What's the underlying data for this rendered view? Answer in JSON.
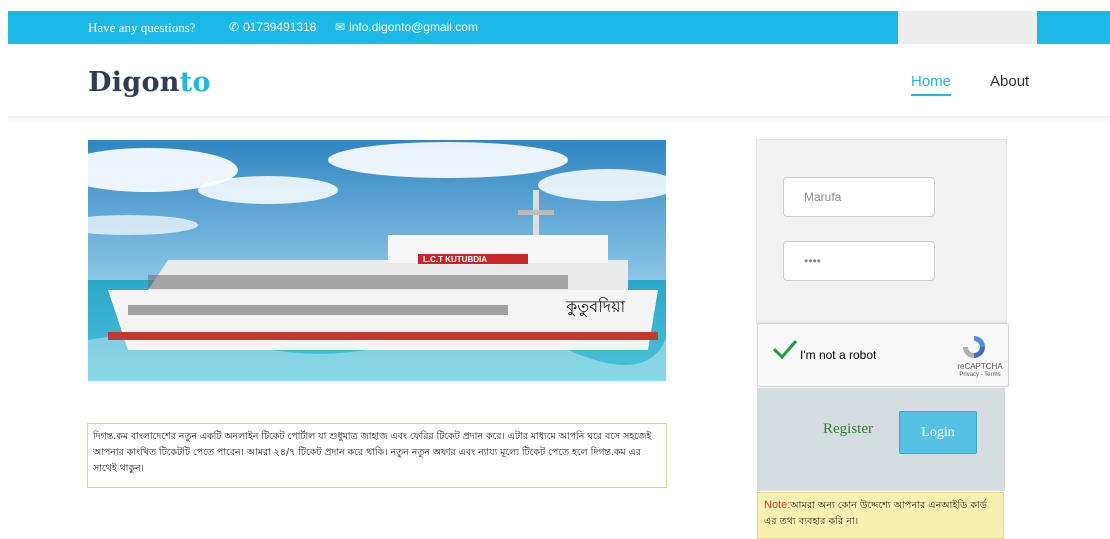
{
  "topbar": {
    "question": "Have any questions?",
    "phone": "01739491318",
    "email": "info.digonto@gmail.com",
    "phone_icon": "phone-icon",
    "mail_icon": "envelope-icon",
    "accent_color": "#1cb8e6"
  },
  "header": {
    "logo_main": "Digon",
    "logo_accent": "to",
    "nav": {
      "home": "Home",
      "about": "About"
    }
  },
  "hero": {
    "ship_name_board": "L.C.T KUTUBDIA",
    "ship_name_bengali": "কুতুবদিয়া"
  },
  "description": "দিগন্ত.কম বাংলাদেশের নতুন একটি অনলাইন টিকেট পোর্টাল যা শুধুমাত্র জাহাজ এবং ফেরির টিকেট প্রদান করে। এটার মাধ্যমে আপনি ঘরে বসে সহজেই আপনার কাংখিত টিকেটটি পেতে পারেন। আমরা ২৪/৭ টিকেট প্রদান করে থাকি। নতুন নতুন অফার এবং ন্যায্য মূল্যে টিকেট পেতে হলে দিগন্ত.কম এর সাথেই থাকুন।",
  "form": {
    "username_value": "Marufa",
    "password_value": "••••",
    "recaptcha": {
      "label": "I'm not a robot",
      "brand": "reCAPTCHA",
      "terms": "Privacy - Terms",
      "checked": true
    },
    "register_label": "Register",
    "login_label": "Login"
  },
  "note": {
    "label": "Note:",
    "text": "আমরা অন্য কোন উদ্দেশ্যে আপনার এনআইডি কার্ড এর তথ্য ব্যবহার করি না।"
  }
}
